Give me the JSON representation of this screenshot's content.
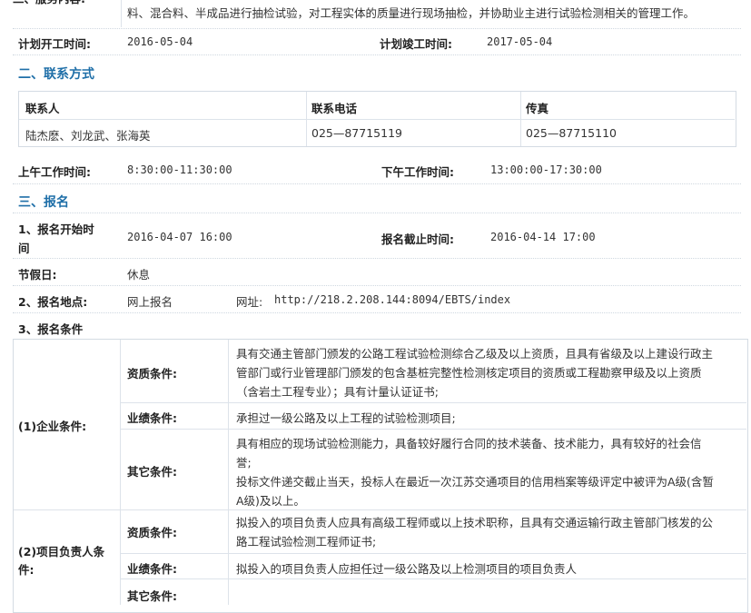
{
  "scope": {
    "line1": "料、混合料、半成品进行抽检试验，对工程实体的质量进行现场抽检，并协助业主进行试验检测相关的管理工作。"
  },
  "plan": {
    "start_label": "计划开工时间:",
    "start_value": "2016-05-04",
    "end_label": "计划竣工时间:",
    "end_value": "2017-05-04"
  },
  "contact": {
    "heading": "二、联系方式",
    "headers": [
      "联系人",
      "联系电话",
      "传真"
    ],
    "row": [
      "陆杰麽、刘龙武、张海英",
      "025—87715119",
      "025—87715110"
    ],
    "am_label": "上午工作时间:",
    "am_value": "8:30:00-11:30:00",
    "pm_label": "下午工作时间:",
    "pm_value": "13:00:00-17:30:00"
  },
  "signup": {
    "heading": "三、报名",
    "start_label_1": "1、报名开始时",
    "start_label_2": "间",
    "start_value": "2016-04-07 16:00",
    "end_label": "报名截止时间:",
    "end_value": "2016-04-14 17:00",
    "holiday_label": "节假日:",
    "holiday_value": "休息",
    "place_label": "2、报名地点:",
    "place_value": "网上报名",
    "url_label": "网址:",
    "url_value": "http://218.2.208.144:8094/EBTS/index",
    "cond_label": "3、报名条件"
  },
  "enterprise": {
    "label": "(1)企业条件:",
    "qual_label": "资质条件:",
    "qual_lines": [
      "具有交通主管部门颁发的公路工程试验检测综合乙级及以上资质，且具有省级及以上建设行政主",
      "管部门或行业管理部门颁发的包含基桩完整性检测核定项目的资质或工程勘察甲级及以上资质",
      "（含岩土工程专业）；具有计量认证证书;"
    ],
    "perf_label": "业绩条件:",
    "perf_value": "承担过一级公路及以上工程的试验检测项目;",
    "other_label": "其它条件:",
    "other_lines": [
      "具有相应的现场试验检测能力，具备较好履行合同的技术装备、技术能力，具有较好的社会信",
      "誉;",
      "投标文件递交截止当天，投标人在最近一次江苏交通项目的信用档案等级评定中被评为A级(含暂",
      "A级)及以上。"
    ]
  },
  "manager": {
    "label_1": "(2)项目负责人条",
    "label_2": "件:",
    "qual_label": "资质条件:",
    "qual_lines": [
      "拟投入的项目负责人应具有高级工程师或以上技术职称，且具有交通运输行政主管部门核发的公",
      "路工程试验检测工程师证书;"
    ],
    "perf_label": "业绩条件:",
    "perf_value": "拟投入的项目负责人应担任过一级公路及以上检测项目的项目负责人",
    "other_label": "其它条件:"
  }
}
